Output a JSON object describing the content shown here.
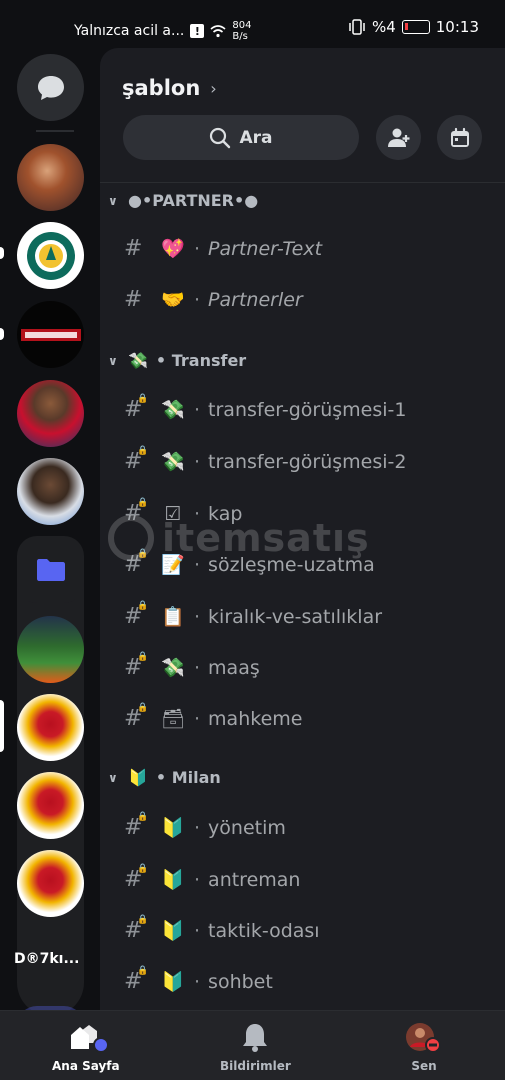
{
  "status_bar": {
    "carrier_text": "Yalnızca acil a...",
    "speed_value": "804",
    "speed_unit": "B/s",
    "battery_text": "%4",
    "time": "10:13"
  },
  "rail": {
    "server_label": "D®7kı..."
  },
  "server": {
    "name": "şablon",
    "search_placeholder": "Ara"
  },
  "categories": [
    {
      "label": "•PARTNER•",
      "prefix": "●",
      "suffix": "●",
      "emoji": ""
    },
    {
      "label": "• Transfer",
      "emoji": "💸"
    },
    {
      "label": "• Milan",
      "emoji": "🔰"
    }
  ],
  "channels": [
    {
      "emoji": "💖",
      "name": "Partner-Text",
      "locked": false,
      "italic": true
    },
    {
      "emoji": "🤝",
      "name": "Partnerler",
      "locked": false,
      "italic": true
    },
    {
      "emoji": "💸",
      "name": "transfer-görüşmesi-1",
      "locked": true,
      "italic": false
    },
    {
      "emoji": "💸",
      "name": "transfer-görüşmesi-2",
      "locked": true,
      "italic": false
    },
    {
      "emoji": "☑",
      "name": "kap",
      "locked": true,
      "italic": false
    },
    {
      "emoji": "📝",
      "name": "sözleşme-uzatma",
      "locked": true,
      "italic": false
    },
    {
      "emoji": "📋",
      "name": "kiralık-ve-satılıklar",
      "locked": true,
      "italic": false
    },
    {
      "emoji": "💸",
      "name": "maaş",
      "locked": true,
      "italic": false
    },
    {
      "emoji": "🗃",
      "name": "mahkeme",
      "locked": true,
      "italic": false
    },
    {
      "emoji": "🔰",
      "name": "yönetim",
      "locked": true,
      "italic": false
    },
    {
      "emoji": "🔰",
      "name": "antreman",
      "locked": true,
      "italic": false
    },
    {
      "emoji": "🔰",
      "name": "taktik-odası",
      "locked": true,
      "italic": false
    },
    {
      "emoji": "🔰",
      "name": "sohbet",
      "locked": true,
      "italic": false
    }
  ],
  "watermark": {
    "text": "itemsatış"
  },
  "bottom_nav": {
    "home": "Ana Sayfa",
    "notifications": "Bildirimler",
    "profile": "Sen"
  },
  "colors": {
    "accent": "#5865f2",
    "dnd": "#f23f43"
  }
}
